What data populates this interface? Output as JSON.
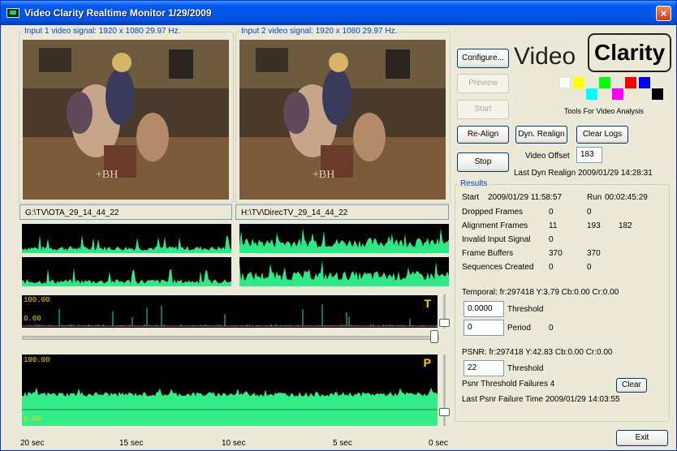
{
  "window": {
    "title": "Video Clarity Realtime Monitor 1/29/2009",
    "close_glyph": "×"
  },
  "inputs": [
    {
      "legend": "Input 1 video signal: 1920 x 1080 29.97 Hz.",
      "path": "G:\\TV\\OTA_29_14_44_22"
    },
    {
      "legend": "Input 2 video signal: 1920 x 1080 29.97 Hz.",
      "path": "H:\\TV\\DirecTV_29_14_44_22"
    }
  ],
  "buttons": {
    "configure": "Configure...",
    "preview": "Preview",
    "start": "Start",
    "realign": "Re-Align",
    "dyn_realign": "Dyn. Realign",
    "clear_logs": "Clear Logs",
    "stop": "Stop",
    "clear": "Clear",
    "exit": "Exit"
  },
  "logo": {
    "word1": "Video",
    "word2": "Clarity",
    "tagline": "Tools For Video Analysis",
    "colors": [
      "#ffffff",
      "#ffff00",
      "#00ffff",
      "#00ff00",
      "#ff00ff",
      "#ff0000",
      "#0000ff",
      "#000000"
    ]
  },
  "video_offset": {
    "label": "Video Offset",
    "value": "183"
  },
  "last_dyn_realign": {
    "label": "Last Dyn Realign",
    "value": "2009/01/29 14:28:31"
  },
  "results": {
    "legend": "Results",
    "start_label": "Start",
    "start_value": "2009/01/29 11:58:57",
    "run_label": "Run",
    "run_value": "00:02:45:29",
    "rows": [
      {
        "label": "Dropped Frames",
        "v1": "0",
        "v2": "0",
        "v3": ""
      },
      {
        "label": "Alignment Frames",
        "v1": "11",
        "v2": "193",
        "v3": "182"
      },
      {
        "label": "Invalid Input Signal",
        "v1": "0",
        "v2": "",
        "v3": ""
      },
      {
        "label": "Frame Buffers",
        "v1": "370",
        "v2": "370",
        "v3": ""
      },
      {
        "label": "Sequences Created",
        "v1": "0",
        "v2": "0",
        "v3": ""
      }
    ],
    "temporal": "Temporal: fr:297418  Y:3.79  Cb:0.00  Cr:0.00",
    "temporal_threshold_value": "0.0000",
    "threshold_label": "Threshold",
    "period_value": "0",
    "period_label": "Period",
    "period_count": "0",
    "psnr": "PSNR:  fr:297418  Y:42.83  Cb:0.00  Cr:0.00",
    "psnr_threshold_value": "22",
    "psnr_failures": "Psnr Threshold Failures  4",
    "last_psnr_failure": "Last Psnr Failure Time  2009/01/29 14:03:55"
  },
  "graphs": {
    "temporal": {
      "letter": "T",
      "top": "100.00",
      "bottom": "0.00"
    },
    "psnr": {
      "letter": "P",
      "top": "100.00",
      "bottom": "0.00"
    }
  },
  "time_axis": [
    "20 sec",
    "15 sec",
    "10 sec",
    "5 sec",
    "0 sec"
  ],
  "audio_color": "#2ee888",
  "psnr_color": "#33ee88"
}
